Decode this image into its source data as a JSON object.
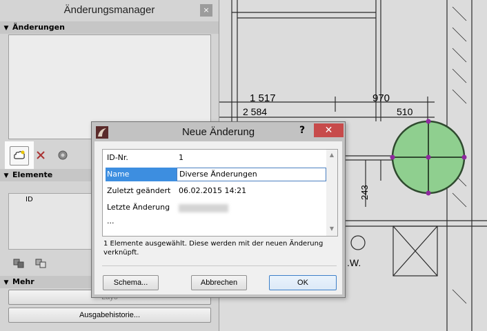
{
  "palette": {
    "title": "Änderungsmanager",
    "close": "×",
    "section_changes": "Änderungen",
    "section_elements": "Elemente",
    "element_column_id": "ID",
    "section_more": "Mehr",
    "layout_button": "Layo",
    "history_button": "Ausgabehistorie..."
  },
  "cad": {
    "dim_1517": "1 517",
    "dim_970": "970",
    "dim_2584": "2 584",
    "dim_510": "510",
    "dim_243": "243",
    "label_w": ".W."
  },
  "dialog": {
    "title": "Neue Änderung",
    "help": "?",
    "close": "✕",
    "rows": [
      {
        "key": "ID-Nr.",
        "value": "1"
      },
      {
        "key": "Name",
        "value": "Diverse Änderungen"
      },
      {
        "key": "Zuletzt geändert",
        "value": "06.02.2015 14:21"
      },
      {
        "key": "Letzte Änderung ...",
        "value": ""
      }
    ],
    "info": "1 Elemente ausgewählt. Diese werden mit der neuen Änderung verknüpft.",
    "schema_button": "Schema...",
    "cancel_button": "Abbrechen",
    "ok_button": "OK"
  },
  "colors": {
    "accent": "#3d8ee0",
    "close_red": "#c74b4b",
    "cad_circle_fill": "#8fcf8f",
    "cad_marker": "#8e2a9e"
  }
}
